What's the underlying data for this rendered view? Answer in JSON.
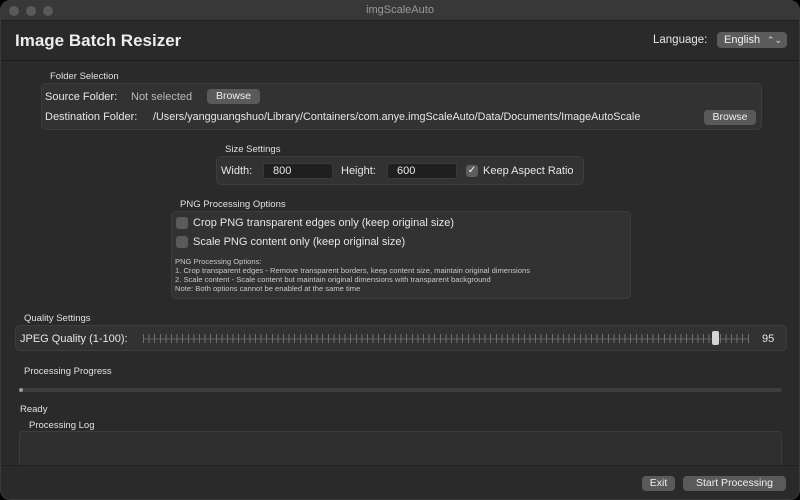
{
  "window": {
    "title": "imgScaleAuto"
  },
  "header": {
    "app_title": "Image Batch Resizer",
    "language_label": "Language:",
    "language_value": "English",
    "language_chevron": "⌃⌄"
  },
  "folders": {
    "section_label": "Folder Selection",
    "source_label": "Source Folder:",
    "source_value": "Not selected",
    "source_browse": "Browse",
    "dest_label": "Destination Folder:",
    "dest_value": "/Users/yangguangshuo/Library/Containers/com.anye.imgScaleAuto/Data/Documents/ImageAutoScale",
    "dest_browse": "Browse"
  },
  "size": {
    "section_label": "Size Settings",
    "width_label": "Width:",
    "width_value": "800",
    "height_label": "Height:",
    "height_value": "600",
    "keep_aspect_label": "Keep Aspect Ratio",
    "keep_aspect_checked": true,
    "check_mark": "✓"
  },
  "png": {
    "section_label": "PNG Processing Options",
    "crop_label": "Crop PNG transparent edges only (keep original size)",
    "crop_checked": false,
    "scale_label": "Scale PNG content only (keep original size)",
    "scale_checked": false,
    "notes": [
      "PNG Processing Options:",
      "1. Crop transparent edges - Remove transparent borders, keep content size, maintain original dimensions",
      "2. Scale content - Scale content but maintain original dimensions with transparent background",
      "Note: Both options cannot be enabled at the same time"
    ]
  },
  "quality": {
    "section_label": "Quality Settings",
    "jpeg_label": "JPEG Quality (1-100):",
    "jpeg_value": "95",
    "jpeg_min": 1,
    "jpeg_max": 100,
    "jpeg_current": 95
  },
  "progress": {
    "section_label": "Processing Progress",
    "fraction": 0,
    "status": "Ready",
    "log_label": "Processing Log"
  },
  "actions": {
    "exit_label": "Exit",
    "start_label": "Start Processing"
  }
}
